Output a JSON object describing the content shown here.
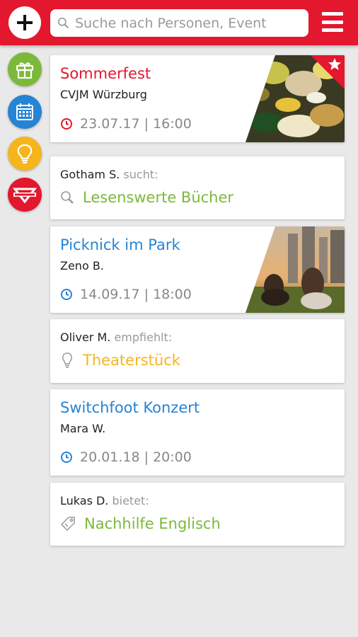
{
  "header": {
    "add_icon": "plus-icon",
    "search_placeholder": "Suche nach Personen, Event",
    "menu_icon": "hamburger-menu-icon",
    "brand_color": "#e3172d"
  },
  "sidebar": [
    {
      "icon": "gift-icon",
      "color": "#7cb93a"
    },
    {
      "icon": "calendar-icon",
      "color": "#2684d4"
    },
    {
      "icon": "lightbulb-icon",
      "color": "#f5b51c"
    },
    {
      "icon": "cvjm-logo-icon",
      "color": "#e3172d"
    }
  ],
  "cards": {
    "c1": {
      "title": "Sommerfest",
      "subtitle": "CVJM Würzburg",
      "date": "23.07.17 | 16:00",
      "featured_icon": "star-icon"
    },
    "c2": {
      "who": "Gotham S.",
      "verb": "sucht:",
      "item": "Lesenswerte Bücher",
      "icon": "search-icon"
    },
    "c3": {
      "title": "Picknick im Park",
      "subtitle": "Zeno B.",
      "date": "14.09.17 | 18:00"
    },
    "c4": {
      "who": "Oliver M.",
      "verb": "empfiehlt:",
      "item": "Theaterstück",
      "icon": "lightbulb-outline-icon"
    },
    "c5": {
      "title": "Switchfoot Konzert",
      "subtitle": "Mara W.",
      "date": "20.01.18 | 20:00"
    },
    "c6": {
      "who": "Lukas D.",
      "verb": "bietet:",
      "item": "Nachhilfe Englisch",
      "icon": "tag-icon"
    }
  },
  "colors": {
    "red": "#e3172d",
    "blue": "#2684d4",
    "green": "#7cb93a",
    "yellow": "#f5b51c",
    "grey": "#888888"
  }
}
